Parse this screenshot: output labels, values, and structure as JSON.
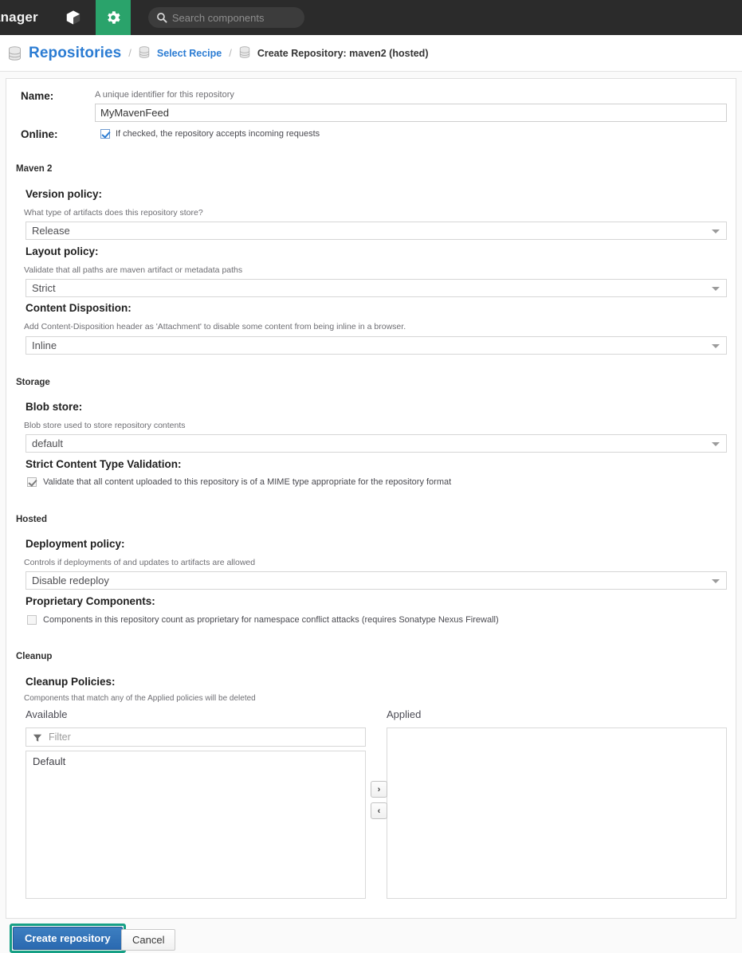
{
  "header": {
    "brand": "lanager",
    "icons": {
      "cube": "cube-icon",
      "gear": "gear-icon",
      "search": "search-icon"
    },
    "search_placeholder": "Search components"
  },
  "breadcrumb": {
    "root": "Repositories",
    "separator": "/",
    "middle": "Select Recipe",
    "current": "Create Repository: maven2 (hosted)"
  },
  "form": {
    "name": {
      "label": "Name:",
      "helper": "A unique identifier for this repository",
      "value": "MyMavenFeed"
    },
    "online": {
      "label": "Online:",
      "text": "If checked, the repository accepts incoming requests",
      "checked": true
    }
  },
  "sections": {
    "maven2": {
      "title": "Maven 2",
      "version_policy": {
        "label": "Version policy:",
        "helper": "What type of artifacts does this repository store?",
        "value": "Release"
      },
      "layout_policy": {
        "label": "Layout policy:",
        "helper": "Validate that all paths are maven artifact or metadata paths",
        "value": "Strict"
      },
      "content_disposition": {
        "label": "Content Disposition:",
        "helper": "Add Content-Disposition header as 'Attachment' to disable some content from being inline in a browser.",
        "value": "Inline"
      }
    },
    "storage": {
      "title": "Storage",
      "blob_store": {
        "label": "Blob store:",
        "helper": "Blob store used to store repository contents",
        "value": "default"
      },
      "strict_content": {
        "label": "Strict Content Type Validation:",
        "text": "Validate that all content uploaded to this repository is of a MIME type appropriate for the repository format",
        "checked": true
      }
    },
    "hosted": {
      "title": "Hosted",
      "deployment_policy": {
        "label": "Deployment policy:",
        "helper": "Controls if deployments of and updates to artifacts are allowed",
        "value": "Disable redeploy"
      },
      "proprietary": {
        "label": "Proprietary Components:",
        "text": "Components in this repository count as proprietary for namespace conflict attacks (requires Sonatype Nexus Firewall)",
        "checked": false
      }
    },
    "cleanup": {
      "title": "Cleanup",
      "policies": {
        "label": "Cleanup Policies:",
        "helper": "Components that match any of the Applied policies will be deleted",
        "available_header": "Available",
        "applied_header": "Applied",
        "filter_placeholder": "Filter",
        "available_items": [
          "Default"
        ],
        "applied_items": [],
        "move_right": "›",
        "move_left": "‹"
      }
    }
  },
  "footer": {
    "primary": "Create repository",
    "secondary": "Cancel"
  },
  "colors": {
    "accent_green": "#2aa36b",
    "link_blue": "#2b7cd3",
    "primary_button": "#2a69b0",
    "highlight_teal": "#16a085",
    "topbar": "#2b2b2b"
  }
}
